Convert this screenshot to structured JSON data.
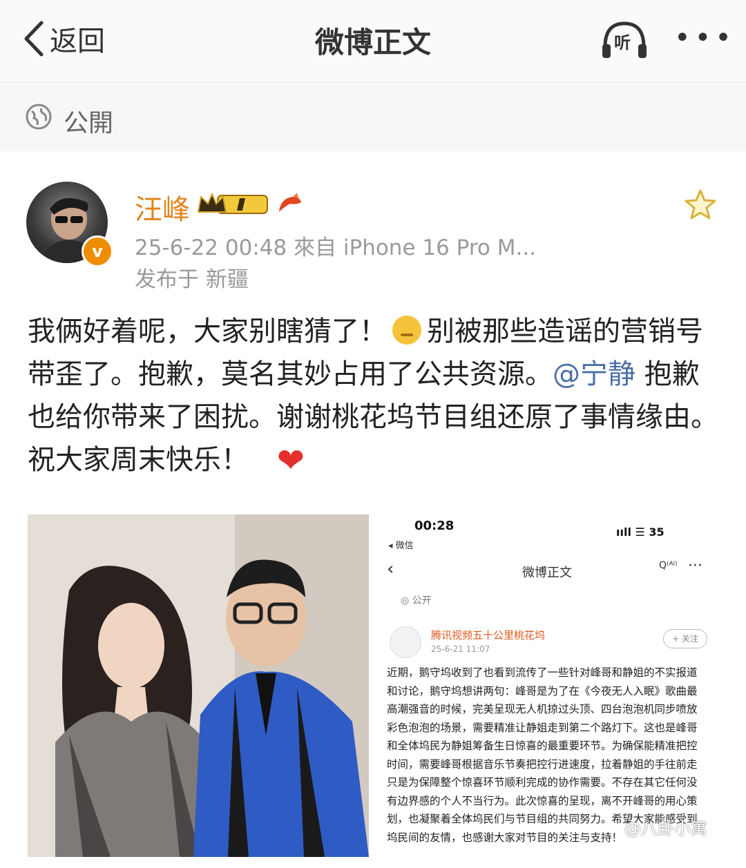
{
  "header": {
    "back_label": "返回",
    "title": "微博正文",
    "listen_label": "听",
    "more_label": "•••"
  },
  "visibility": {
    "icon": "globe-icon",
    "label": "公開"
  },
  "post": {
    "author": "汪峰",
    "verified_mark": "v",
    "timestamp_source": "25-6-22 00:48  來自 iPhone 16 Pro M...",
    "location": "发布于 新疆",
    "content_part1": "我俩好着呢，大家别瞎猜了！",
    "content_part2": "别被那些造谣的营销号带歪了。抱歉，莫名其妙占用了公共资源。",
    "mention": "@宁静",
    "content_part3": " 抱歉也给你带来了困扰。谢谢桃花坞节目组还原了事情缘由。祝大家周末快乐！",
    "heart": "❤"
  },
  "screenshot": {
    "time": "00:28",
    "app_return": "◂ 微信",
    "status": "ııll ☰ 35",
    "back": "‹",
    "title": "微博正文",
    "ai": "Q⁽ᴬᴵ⁾",
    "more": "···",
    "public": "◎ 公开",
    "account_name": "腾讯视频五十公里桃花坞",
    "date": "25-6-21 11:07",
    "follow": "+ 关注",
    "body": "近期，鹅守坞收到了也看到流传了一些针对峰哥和静姐的不实报道和讨论，鹅守坞想讲两句：峰哥是为了在《今夜无人入眠》歌曲最高潮强音的时候，完美呈现无人机掠过头顶、四台泡泡机同步喷放彩色泡泡的场景，需要精准让静姐走到第二个路灯下。这也是峰哥和全体坞民为静姐筹备生日惊喜的最重要环节。为确保能精准把控时间，需要峰哥根据音乐节奏把控行进速度，拉着静姐的手往前走只是为保障整个惊喜环节顺利完成的协作需要。不存在其它任何没有边界感的个人不当行为。此次惊喜的呈现，离不开峰哥的用心策划，也凝聚着全体坞民们与节目组的共同努力。希望大家能感受到坞民间的友情，也感谢大家对节目的关注与支持！"
  },
  "watermark": "@八卦小寓",
  "colors": {
    "accent_orange": "#e0851a",
    "link_blue": "#4a6fa5",
    "meta_gray": "#9a9a9a"
  }
}
